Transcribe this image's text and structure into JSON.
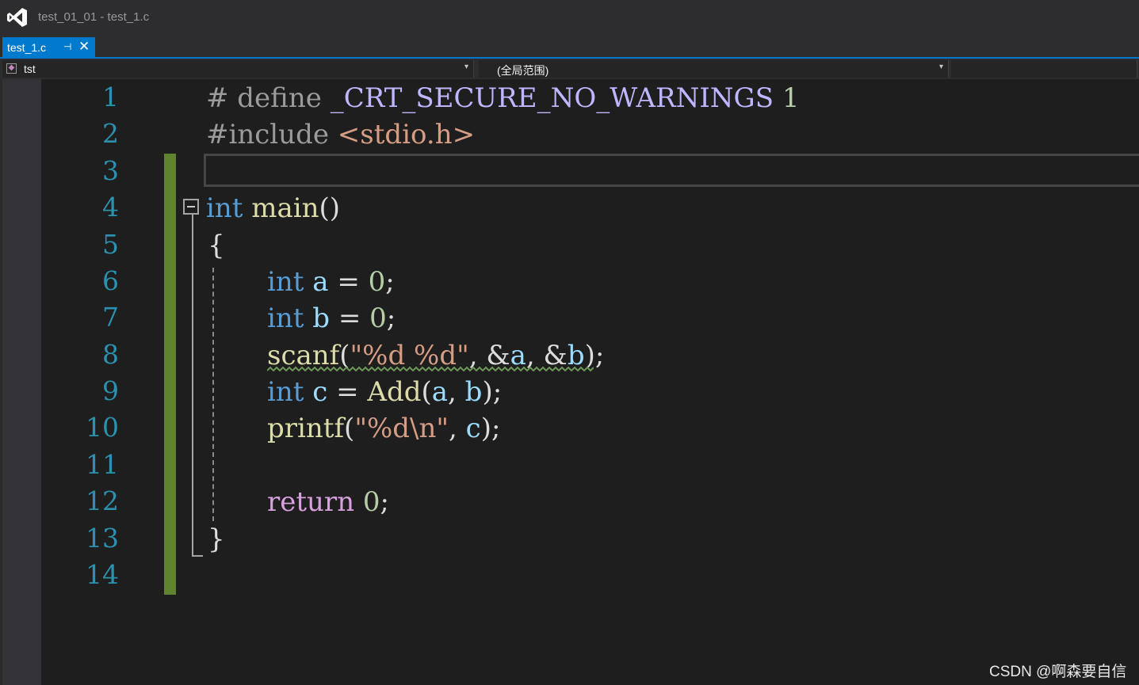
{
  "window": {
    "title": "test_01_01 - test_1.c"
  },
  "tab": {
    "label": "test_1.c",
    "pin_icon": "pin-icon",
    "close_icon": "close-icon"
  },
  "navigation": {
    "project_dropdown": "tst",
    "scope_dropdown": "(全局范围)",
    "member_dropdown": ""
  },
  "editor": {
    "line_numbers": [
      "1",
      "2",
      "3",
      "4",
      "5",
      "6",
      "7",
      "8",
      "9",
      "10",
      "11",
      "12",
      "13",
      "14"
    ],
    "current_line": 3,
    "lines": [
      "# define _CRT_SECURE_NO_WARNINGS 1",
      "#include <stdio.h>",
      "",
      "int main()",
      "{",
      "    int a = 0;",
      "    int b = 0;",
      "    scanf(\"%d %d\", &a, &b);",
      "    int c = Add(a, b);",
      "    printf(\"%d\\n\", c);",
      "",
      "    return 0;",
      "}",
      ""
    ]
  },
  "watermark": "CSDN @啊森要自信",
  "colors": {
    "accent": "#007acc",
    "keyword": "#569cd6",
    "macro": "#beb7ff",
    "number": "#b5cea8",
    "string": "#d69d85",
    "function": "#dcdcaa",
    "variable": "#9cdcfe",
    "control": "#d8a0df",
    "line_number": "#2b91af",
    "change_marker": "#5f832f",
    "squiggle": "#6a9955"
  }
}
